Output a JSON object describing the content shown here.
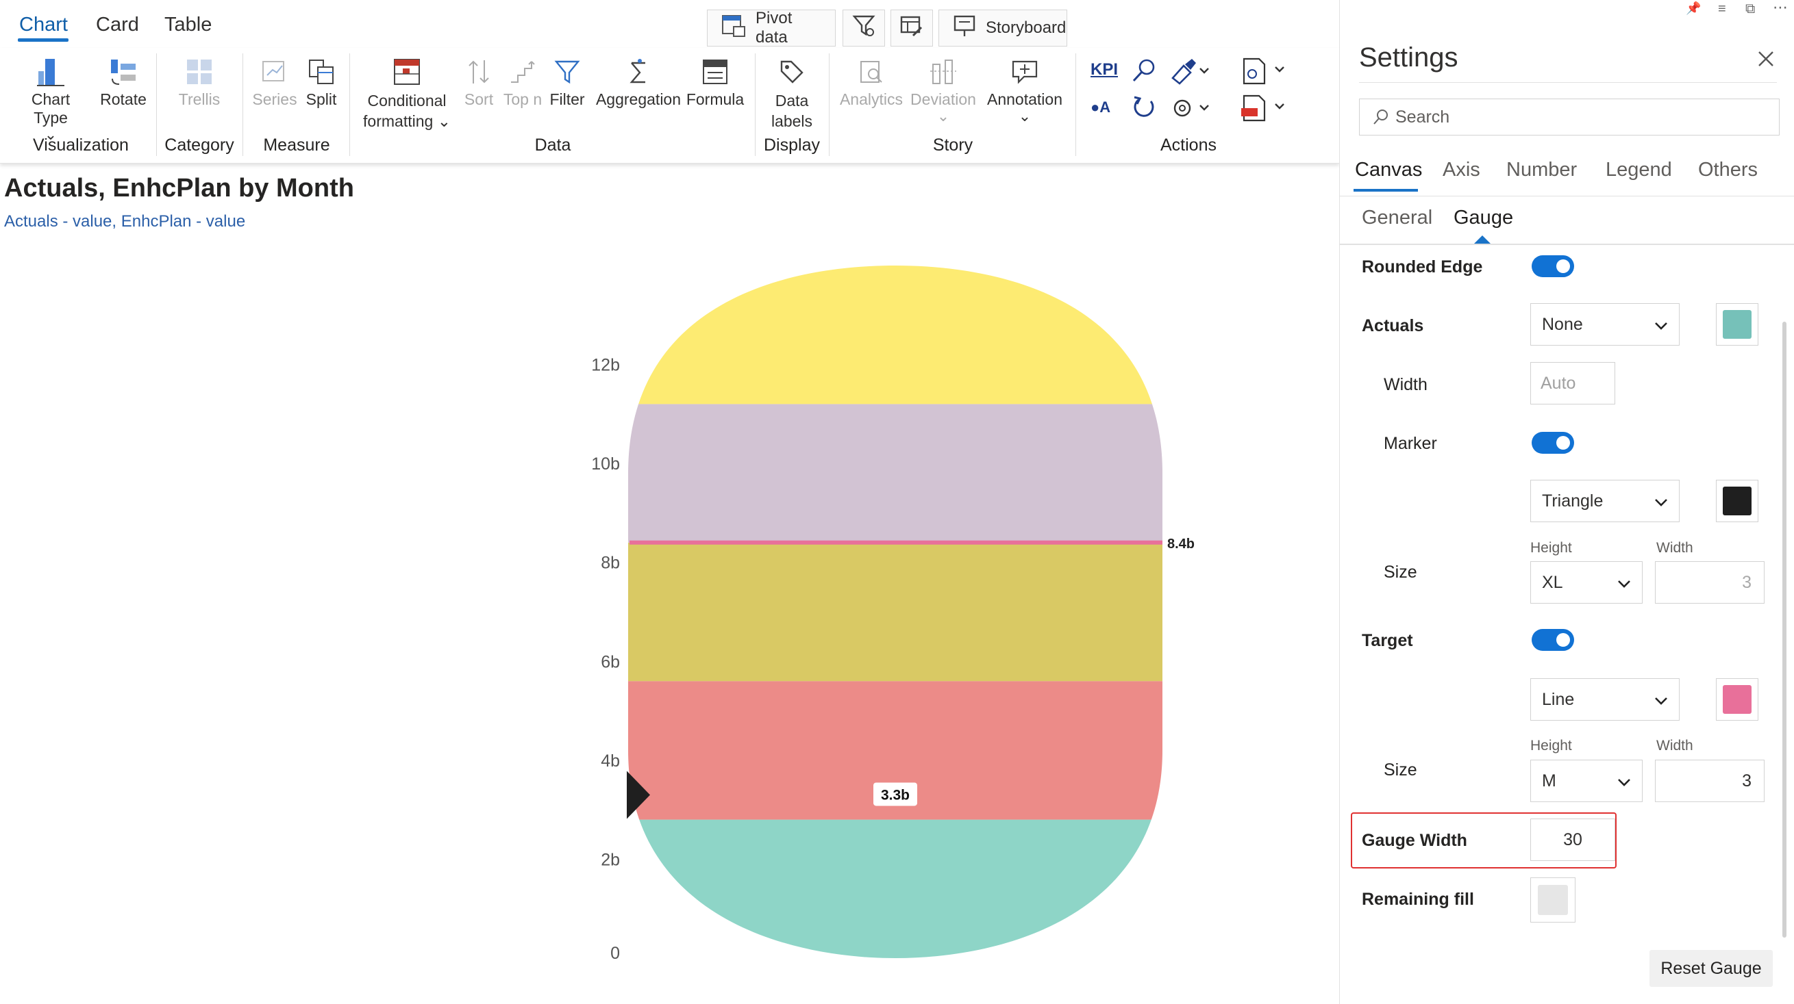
{
  "tabs": [
    {
      "label": "Chart",
      "active": true
    },
    {
      "label": "Card",
      "active": false
    },
    {
      "label": "Table",
      "active": false
    }
  ],
  "top_buttons": {
    "pivot_data": "Pivot data",
    "storyboard": "Storyboard"
  },
  "ribbon": {
    "chart_type": "Chart Type",
    "rotate": "Rotate",
    "trellis": "Trellis",
    "series": "Series",
    "split": "Split",
    "conditional_formatting_line1": "Conditional",
    "conditional_formatting_line2": "formatting",
    "sort": "Sort",
    "top_n": "Top n",
    "filter": "Filter",
    "aggregation": "Aggregation",
    "formula": "Formula",
    "data_labels_line1": "Data",
    "data_labels_line2": "labels",
    "analytics": "Analytics",
    "deviation": "Deviation",
    "annotation": "Annotation",
    "kpi": "KPI",
    "groups": {
      "visualization": "Visualization",
      "category": "Category",
      "measure": "Measure",
      "data": "Data",
      "display": "Display",
      "story": "Story",
      "actions": "Actions"
    }
  },
  "chart": {
    "title": "Actuals, EnhcPlan by Month",
    "subtitle": "Actuals - value, EnhcPlan - value"
  },
  "chart_data": {
    "type": "gauge",
    "title": "Actuals, EnhcPlan by Month",
    "subtitle": "Actuals - value, EnhcPlan - value",
    "y_ticks": [
      "0",
      "2b",
      "4b",
      "6b",
      "8b",
      "10b",
      "12b"
    ],
    "ylim": [
      0,
      14
    ],
    "bands": [
      {
        "from": 0,
        "to": 2.8,
        "color": "#8ed5c7"
      },
      {
        "from": 2.8,
        "to": 5.6,
        "color": "#ec8b88"
      },
      {
        "from": 5.6,
        "to": 8.4,
        "color": "#d9c964"
      },
      {
        "from": 8.4,
        "to": 11.2,
        "color": "#d2c3d3"
      },
      {
        "from": 11.2,
        "to": 14,
        "color": "#fdeb72"
      }
    ],
    "actual": {
      "value": 3.3,
      "label": "3.3b",
      "marker": "triangle",
      "marker_color": "#1f1f1f"
    },
    "target": {
      "value": 8.4,
      "label": "8.4b",
      "shape": "line",
      "color": "#e8709a"
    }
  },
  "settings": {
    "title": "Settings",
    "search_placeholder": "Search",
    "tabs": [
      "Canvas",
      "Axis",
      "Number",
      "Legend",
      "Others"
    ],
    "subtabs": [
      "General",
      "Gauge"
    ],
    "rounded_edge": "Rounded Edge",
    "actuals": {
      "label": "Actuals",
      "shape": "None",
      "color": "#76c1b9"
    },
    "width_label": "Width",
    "width_placeholder": "Auto",
    "marker": {
      "label": "Marker",
      "shape": "Triangle",
      "color": "#1f1f1f"
    },
    "size_label": "Size",
    "height_label": "Height",
    "marker_height": "XL",
    "marker_width": "3",
    "target": {
      "label": "Target",
      "shape": "Line",
      "color": "#e8709a"
    },
    "target_height": "M",
    "target_width": "3",
    "gauge_width_label": "Gauge Width",
    "gauge_width": "30",
    "remaining_fill_label": "Remaining fill",
    "remaining_fill_color": "#e6e6e6",
    "reset_button": "Reset Gauge"
  }
}
